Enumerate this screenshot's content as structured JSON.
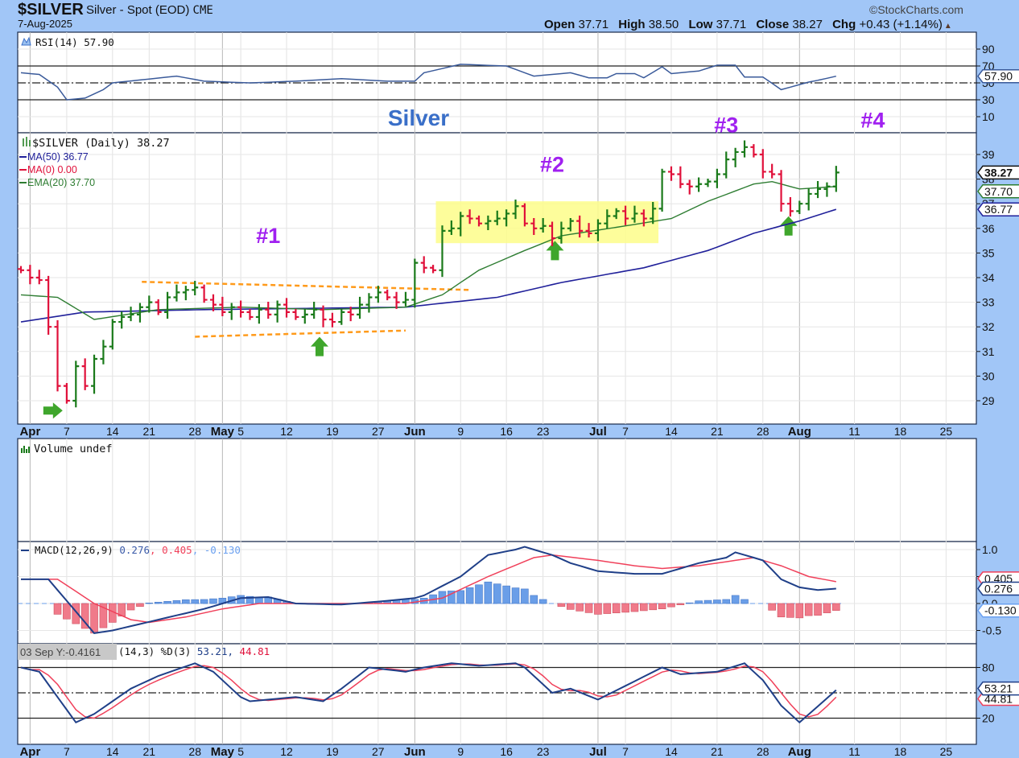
{
  "header": {
    "symbol": "$SILVER",
    "name": "Silver - Spot (EOD)",
    "exchange": "CME",
    "date": "7-Aug-2025",
    "brand": "©StockCharts.com",
    "open_label": "Open",
    "open": "37.71",
    "high_label": "High",
    "high": "38.50",
    "low_label": "Low",
    "low": "37.71",
    "close_label": "Close",
    "close": "38.27",
    "chg_label": "Chg",
    "chg": "+0.43 (+1.14%)",
    "up_arrow": "▲"
  },
  "colors": {
    "up": "#1a7a1a",
    "down": "#e0103a",
    "ma50": "#20209a",
    "ema20": "#2e7d32",
    "macd": "#1f3f88",
    "signal": "#f0405a",
    "hist_pos": "#6a9ee8",
    "hist_neg": "#f07a8a",
    "highlight": "#fdfd8a",
    "trend": "#ff9a1a",
    "arrow": "#3fa62c",
    "annot": "#a020f0",
    "title": "#3a6fc8"
  },
  "legends": {
    "rsi": "RSI(14) 57.90",
    "price": "$SILVER (Daily) 38.27",
    "ma50": "MA(50) 36.77",
    "ma0": "MA(0) 0.00",
    "ema20": "EMA(20) 37.70",
    "volume": "Volume undef",
    "macd_name": "MACD(12,26,9)",
    "macd_val": "0.276",
    "macd_sep1": ",",
    "macd_sig": "0.405",
    "macd_sep2": ",",
    "macd_hist": "-0.130",
    "stoch_tooltip": "03 Sep Y:-0.4161",
    "stoch_name": "(14,3) %D(3)",
    "stoch_k": "53.21",
    "stoch_sep": ",",
    "stoch_d": "44.81"
  },
  "tags": {
    "rsi": "57.90",
    "price": "38.27",
    "ema20": "37.70",
    "ma50": "36.77",
    "macd_sig": "0.405",
    "macd": "0.276",
    "macd_hist": "-0.130",
    "stoch_k": "53.21",
    "stoch_d": "44.81"
  },
  "chart_data": {
    "type": "ohlc",
    "title": "Silver",
    "annotations": [
      {
        "text": "Silver",
        "kind": "title"
      },
      {
        "text": "#1",
        "index": 27,
        "price": 35.4
      },
      {
        "text": "#2",
        "index": 58,
        "price": 38.3
      },
      {
        "text": "#3",
        "index": 77,
        "price": 39.9
      },
      {
        "text": "#4",
        "index": 93,
        "price": 40.1
      }
    ],
    "arrows": [
      {
        "dir": "right",
        "index": 3.5,
        "price": 28.6
      },
      {
        "dir": "up",
        "index": 32.6,
        "price": 31.2
      },
      {
        "dir": "up",
        "index": 58.3,
        "price": 35.1
      },
      {
        "dir": "up",
        "index": 83.8,
        "price": 36.1
      }
    ],
    "highlight_box": {
      "from_index": 45.3,
      "to_index": 69.6,
      "price_low": 35.4,
      "price_high": 37.1
    },
    "trendlines": [
      {
        "from": [
          13.2,
          33.83
        ],
        "to": [
          48.9,
          33.5
        ]
      },
      {
        "from": [
          19,
          31.6
        ],
        "to": [
          42,
          31.85
        ]
      }
    ],
    "closes": [
      34.3,
      34.0,
      33.9,
      32.0,
      29.6,
      29.0,
      30.4,
      29.6,
      30.7,
      31.2,
      32.2,
      32.4,
      32.5,
      32.8,
      33.0,
      32.6,
      33.2,
      33.4,
      33.5,
      33.6,
      33.1,
      32.9,
      32.6,
      32.8,
      32.6,
      32.4,
      32.7,
      32.5,
      32.9,
      32.6,
      32.4,
      32.5,
      32.7,
      32.3,
      32.2,
      32.6,
      32.5,
      32.9,
      33.2,
      33.4,
      33.2,
      33.0,
      33.1,
      34.6,
      34.4,
      34.3,
      35.9,
      36.0,
      36.5,
      36.4,
      36.2,
      36.3,
      36.4,
      36.6,
      36.9,
      36.2,
      36.0,
      36.1,
      35.6,
      36.0,
      36.3,
      35.9,
      35.8,
      36.2,
      36.5,
      36.7,
      36.4,
      36.6,
      36.4,
      36.8,
      38.3,
      38.2,
      37.8,
      37.7,
      37.8,
      37.9,
      38.2,
      38.8,
      39.1,
      39.3,
      39.0,
      38.3,
      38.2,
      37.0,
      36.7,
      37.0,
      37.4,
      37.6,
      37.7,
      38.27
    ],
    "ma50": [
      [
        0,
        32.2
      ],
      [
        7,
        32.6
      ],
      [
        20,
        32.7
      ],
      [
        42,
        32.8
      ],
      [
        47,
        33.0
      ],
      [
        52,
        33.2
      ],
      [
        59,
        33.8
      ],
      [
        68,
        34.4
      ],
      [
        75,
        35.1
      ],
      [
        80,
        35.8
      ],
      [
        85,
        36.3
      ],
      [
        89,
        36.77
      ]
    ],
    "ema20": [
      [
        0,
        33.3
      ],
      [
        4,
        33.2
      ],
      [
        8,
        32.3
      ],
      [
        15,
        32.7
      ],
      [
        24,
        32.8
      ],
      [
        33,
        32.7
      ],
      [
        42,
        32.8
      ],
      [
        46,
        33.3
      ],
      [
        50,
        34.3
      ],
      [
        55,
        35.1
      ],
      [
        59,
        35.7
      ],
      [
        66,
        36.1
      ],
      [
        71,
        36.4
      ],
      [
        75,
        37.1
      ],
      [
        80,
        37.8
      ],
      [
        82,
        37.9
      ],
      [
        85,
        37.6
      ],
      [
        89,
        37.7
      ]
    ],
    "price_axis": {
      "ticks": [
        39,
        38,
        37,
        36,
        35,
        34,
        33,
        32,
        31,
        30,
        29
      ]
    },
    "rsi": {
      "levels": [
        70,
        50,
        30
      ],
      "ticks": [
        90,
        70,
        50,
        30,
        10
      ],
      "values": [
        [
          0,
          62
        ],
        [
          2,
          60
        ],
        [
          4,
          45
        ],
        [
          5,
          30
        ],
        [
          7,
          32
        ],
        [
          9,
          42
        ],
        [
          10,
          50
        ],
        [
          17,
          58
        ],
        [
          20,
          52
        ],
        [
          25,
          50
        ],
        [
          30,
          52
        ],
        [
          35,
          55
        ],
        [
          40,
          52
        ],
        [
          43,
          52
        ],
        [
          44,
          62
        ],
        [
          48,
          72
        ],
        [
          53,
          70
        ],
        [
          56,
          58
        ],
        [
          60,
          62
        ],
        [
          62,
          56
        ],
        [
          64,
          56
        ],
        [
          65,
          61
        ],
        [
          67,
          61
        ],
        [
          68,
          56
        ],
        [
          70,
          69
        ],
        [
          71,
          61
        ],
        [
          74,
          64
        ],
        [
          76,
          71
        ],
        [
          78,
          71
        ],
        [
          79,
          57
        ],
        [
          81,
          57
        ],
        [
          83,
          42
        ],
        [
          86,
          51
        ],
        [
          87,
          53
        ],
        [
          89,
          57.9
        ]
      ]
    },
    "macd": {
      "ticks": [
        "1.0",
        "0.5",
        "0.0",
        "-0.5"
      ],
      "line": [
        [
          0,
          0.45
        ],
        [
          3,
          0.45
        ],
        [
          8,
          -0.55
        ],
        [
          10,
          -0.5
        ],
        [
          15,
          -0.3
        ],
        [
          20,
          -0.1
        ],
        [
          24,
          0.1
        ],
        [
          27,
          0.12
        ],
        [
          30,
          0.0
        ],
        [
          35,
          -0.02
        ],
        [
          40,
          0.05
        ],
        [
          43,
          0.1
        ],
        [
          44,
          0.15
        ],
        [
          48,
          0.5
        ],
        [
          51,
          0.9
        ],
        [
          54,
          1.0
        ],
        [
          55,
          1.05
        ],
        [
          58,
          0.9
        ],
        [
          60,
          0.75
        ],
        [
          63,
          0.6
        ],
        [
          67,
          0.55
        ],
        [
          70,
          0.55
        ],
        [
          72,
          0.65
        ],
        [
          74,
          0.75
        ],
        [
          77,
          0.85
        ],
        [
          78,
          0.95
        ],
        [
          81,
          0.8
        ],
        [
          83,
          0.45
        ],
        [
          85,
          0.3
        ],
        [
          87,
          0.25
        ],
        [
          89,
          0.276
        ]
      ],
      "signal": [
        [
          0,
          0.45
        ],
        [
          4,
          0.45
        ],
        [
          8,
          0.0
        ],
        [
          12,
          -0.3
        ],
        [
          14,
          -0.35
        ],
        [
          18,
          -0.25
        ],
        [
          22,
          -0.1
        ],
        [
          26,
          0.0
        ],
        [
          42,
          0.0
        ],
        [
          46,
          0.1
        ],
        [
          51,
          0.5
        ],
        [
          56,
          0.85
        ],
        [
          58,
          0.9
        ],
        [
          63,
          0.8
        ],
        [
          67,
          0.7
        ],
        [
          70,
          0.65
        ],
        [
          74,
          0.7
        ],
        [
          78,
          0.8
        ],
        [
          80,
          0.85
        ],
        [
          83,
          0.7
        ],
        [
          86,
          0.5
        ],
        [
          89,
          0.405
        ]
      ]
    },
    "stoch": {
      "levels": [
        80,
        50,
        20
      ],
      "ticks": [
        80,
        20
      ],
      "k": [
        [
          0,
          80
        ],
        [
          2,
          75
        ],
        [
          6,
          15
        ],
        [
          8,
          25
        ],
        [
          12,
          55
        ],
        [
          15,
          70
        ],
        [
          19,
          85
        ],
        [
          21,
          75
        ],
        [
          23,
          55
        ],
        [
          24,
          45
        ],
        [
          25,
          40
        ],
        [
          30,
          45
        ],
        [
          33,
          40
        ],
        [
          35,
          55
        ],
        [
          38,
          80
        ],
        [
          42,
          75
        ],
        [
          44,
          80
        ],
        [
          47,
          85
        ],
        [
          50,
          82
        ],
        [
          54,
          85
        ],
        [
          55,
          80
        ],
        [
          58,
          50
        ],
        [
          60,
          55
        ],
        [
          63,
          42
        ],
        [
          70,
          80
        ],
        [
          72,
          72
        ],
        [
          76,
          75
        ],
        [
          79,
          85
        ],
        [
          81,
          65
        ],
        [
          83,
          35
        ],
        [
          85,
          15
        ],
        [
          89,
          53.21
        ]
      ],
      "d_last": 44.81
    },
    "x_labels": [
      {
        "text": "Apr",
        "index": 1,
        "bold": true
      },
      {
        "text": "7",
        "index": 5
      },
      {
        "text": "14",
        "index": 10
      },
      {
        "text": "21",
        "index": 14
      },
      {
        "text": "28",
        "index": 19
      },
      {
        "text": "May",
        "index": 22,
        "bold": true
      },
      {
        "text": "5",
        "index": 24
      },
      {
        "text": "12",
        "index": 29
      },
      {
        "text": "19",
        "index": 34
      },
      {
        "text": "27",
        "index": 39
      },
      {
        "text": "Jun",
        "index": 43,
        "bold": true
      },
      {
        "text": "9",
        "index": 48
      },
      {
        "text": "16",
        "index": 53
      },
      {
        "text": "23",
        "index": 57
      },
      {
        "text": "Jul",
        "index": 63,
        "bold": true
      },
      {
        "text": "7",
        "index": 66
      },
      {
        "text": "14",
        "index": 71
      },
      {
        "text": "21",
        "index": 76
      },
      {
        "text": "28",
        "index": 81
      },
      {
        "text": "Aug",
        "index": 85,
        "bold": true
      },
      {
        "text": "11",
        "index": 91
      },
      {
        "text": "18",
        "index": 96
      },
      {
        "text": "25",
        "index": 101
      }
    ]
  }
}
